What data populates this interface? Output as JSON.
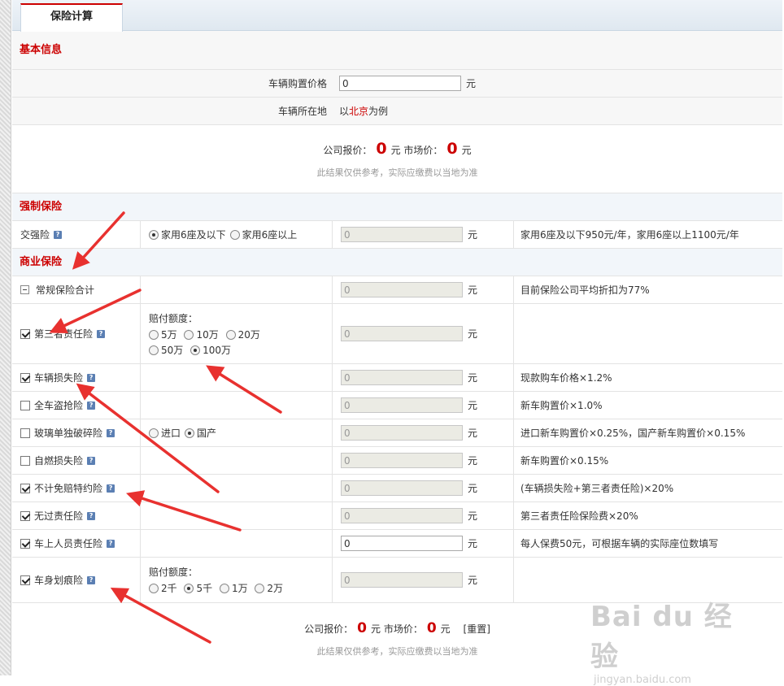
{
  "tab": {
    "label": "保险计算"
  },
  "basic": {
    "title": "基本信息",
    "purchase_price_label": "车辆购置价格",
    "purchase_price_value": "0",
    "unit": "元",
    "location_label": "车辆所在地",
    "location_prefix": "以",
    "location_city": "北京",
    "location_suffix": "为例"
  },
  "summary_top": {
    "company_label": "公司报价：",
    "company_value": "0",
    "unit": "元",
    "market_label": "市场价：",
    "market_value": "0",
    "note": "此结果仅供参考，实际应缴费以当地为准"
  },
  "compulsory": {
    "title": "强制保险",
    "row": {
      "label": "交强险",
      "options": [
        "家用6座及以下",
        "家用6座以上"
      ],
      "selected": 0,
      "value": "0",
      "unit": "元",
      "desc": "家用6座及以下950元/年，家用6座以上1100元/年"
    }
  },
  "commercial": {
    "title": "商业保险",
    "total": {
      "label": "常规保险合计",
      "value": "0",
      "unit": "元",
      "desc": "目前保险公司平均折扣为77%"
    },
    "third_party": {
      "label": "第三者责任险",
      "checked": true,
      "compen_label": "赔付额度：",
      "options_line1": [
        "5万",
        "10万",
        "20万"
      ],
      "options_line2": [
        "50万",
        "100万"
      ],
      "selected": "100万",
      "value": "0",
      "unit": "元",
      "desc": ""
    },
    "vehicle_loss": {
      "label": "车辆损失险",
      "checked": true,
      "value": "0",
      "unit": "元",
      "desc": "现款购车价格×1.2%"
    },
    "theft": {
      "label": "全车盗抢险",
      "checked": false,
      "value": "0",
      "unit": "元",
      "desc": "新车购置价×1.0%"
    },
    "glass": {
      "label": "玻璃单独破碎险",
      "checked": false,
      "options": [
        "进口",
        "国产"
      ],
      "selected": 1,
      "value": "0",
      "unit": "元",
      "desc": "进口新车购置价×0.25%，国产新车购置价×0.15%"
    },
    "fire": {
      "label": "自燃损失险",
      "checked": false,
      "value": "0",
      "unit": "元",
      "desc": "新车购置价×0.15%"
    },
    "deductible": {
      "label": "不计免赔特约险",
      "checked": true,
      "value": "0",
      "unit": "元",
      "desc": "(车辆损失险+第三者责任险)×20%"
    },
    "no_fault": {
      "label": "无过责任险",
      "checked": true,
      "value": "0",
      "unit": "元",
      "desc": "第三者责任险保险费×20%"
    },
    "passenger": {
      "label": "车上人员责任险",
      "checked": true,
      "value": "0",
      "unit": "元",
      "desc": "每人保费50元，可根据车辆的实际座位数填写"
    },
    "scratch": {
      "label": "车身划痕险",
      "checked": true,
      "compen_label": "赔付额度：",
      "options": [
        "2千",
        "5千",
        "1万",
        "2万"
      ],
      "selected": 1,
      "value": "0",
      "unit": "元",
      "desc": ""
    }
  },
  "summary_bottom": {
    "company_label": "公司报价：",
    "company_value": "0",
    "unit": "元",
    "market_label": "市场价：",
    "market_value": "0",
    "reset_label": "[重置]",
    "note": "此结果仅供参考，实际应缴费以当地为准"
  },
  "colors": {
    "accent": "#cc0000",
    "arrow": "#e8312f"
  },
  "watermark": {
    "logo": "Bai du 经验",
    "url": "jingyan.baidu.com"
  }
}
